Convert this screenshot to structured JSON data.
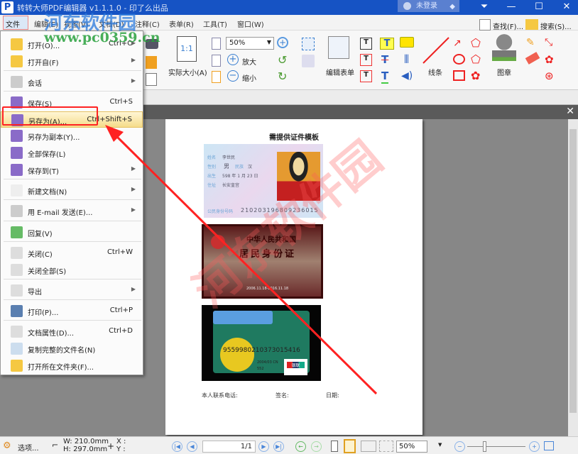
{
  "app": {
    "title": "转转大师PDF编辑器 v1.1.1.0 - 印了么出品",
    "logo": "P",
    "login": "未登录"
  },
  "menubar": [
    "文件",
    "编辑(E)",
    "视图(V)",
    "文档(D)",
    "注释(C)",
    "表单(R)",
    "工具(T)",
    "窗口(W)"
  ],
  "toolbar": {
    "zoom_value": "50%",
    "actual_size": "实际大小(A)",
    "actual_size_icon": "1:1",
    "zoom_in": "放大",
    "zoom_out": "缩小",
    "edit_form": "编辑表单",
    "lines": "线条",
    "stamp": "图章",
    "find": "查找(F)...",
    "search": "搜索(S)..."
  },
  "file_menu": [
    {
      "label": "打开(O)...",
      "shortcut": "Ctrl+O",
      "arrow": true
    },
    {
      "label": "打开自(F)",
      "shortcut": "",
      "arrow": true
    },
    {
      "label": "会话",
      "shortcut": "",
      "arrow": true
    },
    {
      "label": "保存(S)",
      "shortcut": "Ctrl+S",
      "arrow": false
    },
    {
      "label": "另存为(A)...",
      "shortcut": "Ctrl+Shift+S",
      "arrow": false
    },
    {
      "label": "另存为副本(Y)...",
      "shortcut": "",
      "arrow": false
    },
    {
      "label": "全部保存(L)",
      "shortcut": "",
      "arrow": false
    },
    {
      "label": "保存到(T)",
      "shortcut": "",
      "arrow": true
    },
    {
      "label": "新建文档(N)",
      "shortcut": "",
      "arrow": true
    },
    {
      "label": "用 E-mail 发送(E)...",
      "shortcut": "",
      "arrow": true
    },
    {
      "label": "回复(V)",
      "shortcut": "",
      "arrow": false
    },
    {
      "label": "关闭(C)",
      "shortcut": "Ctrl+W",
      "arrow": false
    },
    {
      "label": "关闭全部(S)",
      "shortcut": "",
      "arrow": false
    },
    {
      "label": "导出",
      "shortcut": "",
      "arrow": true
    },
    {
      "label": "打印(P)...",
      "shortcut": "Ctrl+P",
      "arrow": false
    },
    {
      "label": "文档属性(D)...",
      "shortcut": "Ctrl+D",
      "arrow": false
    },
    {
      "label": "复制完整的文件名(N)",
      "shortcut": "",
      "arrow": false
    },
    {
      "label": "打开所在文件夹(F)...",
      "shortcut": "",
      "arrow": false
    }
  ],
  "document": {
    "heading": "需提供证件模板",
    "id_front": {
      "name_label": "姓名",
      "name": "李世民",
      "sex_label": "性别",
      "sex": "男",
      "ethnic_label": "民族",
      "ethnic": "汉",
      "birth_label": "出生",
      "birth": "598 年 1 月 23 日",
      "addr_label": "住址",
      "addr": "长安皇宫",
      "id_label": "公民身份号码",
      "id_number": "210203196809236015"
    },
    "id_back": {
      "line1": "中华人民共和国",
      "line2": "居民身份证",
      "validity": "2006.11.18-2016.11.18"
    },
    "bank_card": {
      "number": "9559980210373015416",
      "date": "2004/03 CN",
      "code": "552",
      "brand": "银联"
    },
    "footer": {
      "phone": "本人联系电话:",
      "sign": "签名:",
      "date": "日期:"
    }
  },
  "statusbar": {
    "options": "选项...",
    "width": "W: 210.0mm",
    "height": "H: 297.0mm",
    "x": "X :",
    "y": "Y :",
    "page": "1/1",
    "zoom": "50%"
  },
  "watermarks": {
    "site_name": "河东软件园",
    "site_url": "www.pc0359.cn"
  },
  "colors": {
    "title_blue": "#1653c4",
    "highlight": "#f5dc8a",
    "annotation_red": "#ff2020"
  }
}
